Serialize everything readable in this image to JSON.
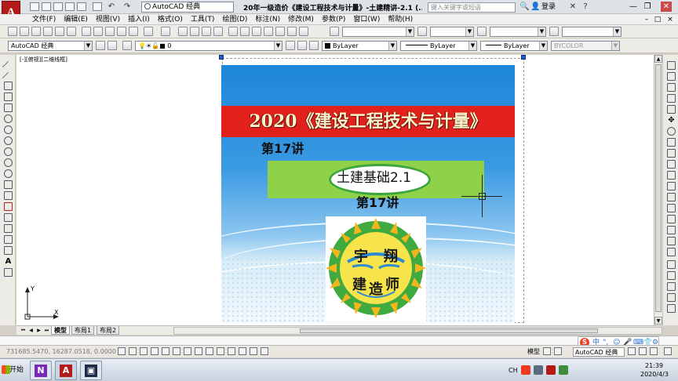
{
  "titlebar": {
    "workspace": "AutoCAD 经典",
    "title": "20年一级造价《建设工程技术与计量》-土建精讲-2.1 (...",
    "search_placeholder": "键入关键字或短语",
    "login": "登录",
    "minimize": "—",
    "restore": "❐",
    "close": "✕"
  },
  "menu": {
    "items": [
      "文件(F)",
      "编辑(E)",
      "视图(V)",
      "插入(I)",
      "格式(O)",
      "工具(T)",
      "绘图(D)",
      "标注(N)",
      "修改(M)",
      "参数(P)",
      "窗口(W)",
      "帮助(H)"
    ]
  },
  "toolbar": {
    "style_combo": "AutoCAD 经典",
    "layer_combo": "0",
    "color_combo": "ByLayer",
    "linetype_combo": "ByLayer",
    "lineweight_combo": "ByLayer",
    "plotstyle_combo": "BYCOLOR"
  },
  "drawing": {
    "viewport_label": "[-][俯视][二维线框]",
    "ucs_x": "X",
    "ucs_y": "Y"
  },
  "slide": {
    "course_title": "2020《建设工程技术与计量》",
    "lecture_top": "第17讲",
    "subject_title": "土建基础2.1",
    "lecture_bottom": "第17讲",
    "logo_chars": [
      "宇",
      "翔",
      "建",
      "造",
      "师"
    ]
  },
  "tabs": {
    "items": [
      "模型",
      "布局1",
      "布局2"
    ]
  },
  "status": {
    "coordinates": "731685.5470, 16287.0518, 0.0000",
    "model_label": "模型",
    "workspace": "AutoCAD 经典"
  },
  "ime": {
    "logo": "S",
    "items": [
      "中",
      "°,",
      "☺",
      "🎤",
      "⌨",
      "👕",
      "⚙"
    ]
  },
  "taskbar": {
    "start": "开始",
    "lang": "CH",
    "time": "21:39",
    "date": "2020/4/3"
  },
  "colors": {
    "banner_red": "#e2211c",
    "banner_green": "#8fd24a",
    "sky_blue": "#1d86d8",
    "accent_autocad": "#b31b1b"
  }
}
